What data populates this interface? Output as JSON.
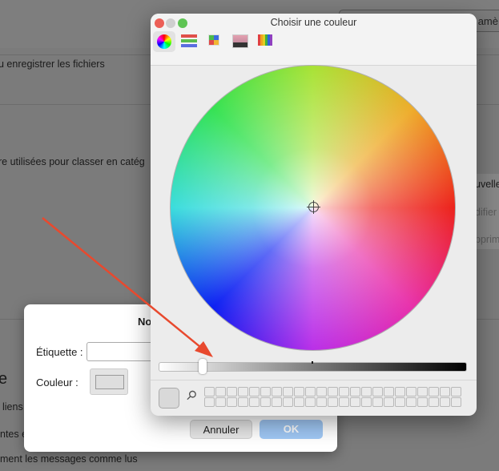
{
  "background": {
    "texts": [
      "u enregistrer les fichiers",
      "re utilisées pour classer en catég",
      "uvelle",
      "difier",
      "pprim",
      "e",
      "liens",
      "ntes e",
      "ment les messages comme lus"
    ],
    "top_button": "amè"
  },
  "color_panel": {
    "title": "Choisir une couleur",
    "tools": [
      "color-wheel",
      "color-sliders",
      "color-palettes",
      "image-palettes",
      "crayons"
    ],
    "brightness_percent": 15
  },
  "dialog": {
    "title": "No",
    "label_field": "Étiquette :",
    "label_value": "",
    "color_label": "Couleur :",
    "cancel": "Annuler",
    "ok": "OK"
  },
  "colors": {
    "accent_ok": "#a0c8f5",
    "arrow": "#e8492e"
  }
}
